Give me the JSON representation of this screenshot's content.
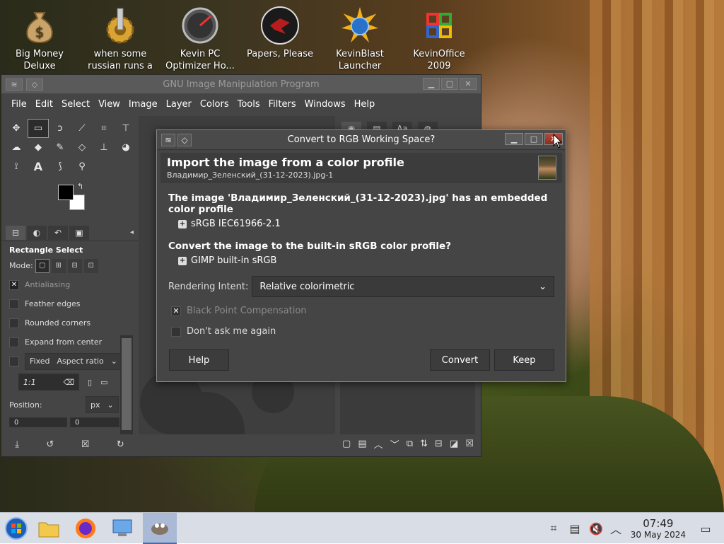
{
  "desktop_icons": [
    {
      "line1": "Big Money",
      "line2": "Deluxe",
      "icon": "money-bag-icon"
    },
    {
      "line1": "when some",
      "line2": "russian runs a",
      "icon": "gear-icon"
    },
    {
      "line1": "Kevin PC",
      "line2": "Optimizer Ho...",
      "icon": "gauge-icon"
    },
    {
      "line1": "Papers, Please",
      "line2": "",
      "icon": "emblem-icon"
    },
    {
      "line1": "KevinBlast",
      "line2": "Launcher",
      "icon": "globe-burst-icon"
    },
    {
      "line1": "KevinOffice",
      "line2": "2009",
      "icon": "office-logo-icon"
    }
  ],
  "gimp": {
    "title": "GNU Image Manipulation Program",
    "menu": [
      "File",
      "Edit",
      "Select",
      "View",
      "Image",
      "Layer",
      "Colors",
      "Tools",
      "Filters",
      "Windows",
      "Help"
    ],
    "tool_options": {
      "title": "Rectangle Select",
      "mode_label": "Mode:",
      "antialiasing": "Antialiasing",
      "feather_edges": "Feather edges",
      "rounded_corners": "Rounded corners",
      "expand_from_center": "Expand from center",
      "fixed": "Fixed",
      "aspect_ratio": "Aspect ratio",
      "ratio_value": "1:1",
      "position_label": "Position:",
      "position_unit": "px",
      "pos_x": "0",
      "pos_y": "0"
    }
  },
  "dialog": {
    "title": "Convert to RGB Working Space?",
    "heading": "Import the image from a color profile",
    "filename": "Владимир_Зеленский_(31-12-2023).jpg-1",
    "embedded_text": "The image 'Владимир_Зеленский_(31-12-2023).jpg' has an embedded color profile",
    "embedded_profile": "sRGB IEC61966-2.1",
    "convert_question": "Convert the image to the built-in sRGB color profile?",
    "builtin_profile": "GIMP built-in sRGB",
    "intent_label": "Rendering Intent:",
    "intent_value": "Relative colorimetric",
    "black_point": "Black Point Compensation",
    "dont_ask": "Don't ask me again",
    "help_button": "Help",
    "convert_button": "Convert",
    "keep_button": "Keep"
  },
  "taskbar": {
    "time": "07:49",
    "date": "30 May 2024"
  }
}
